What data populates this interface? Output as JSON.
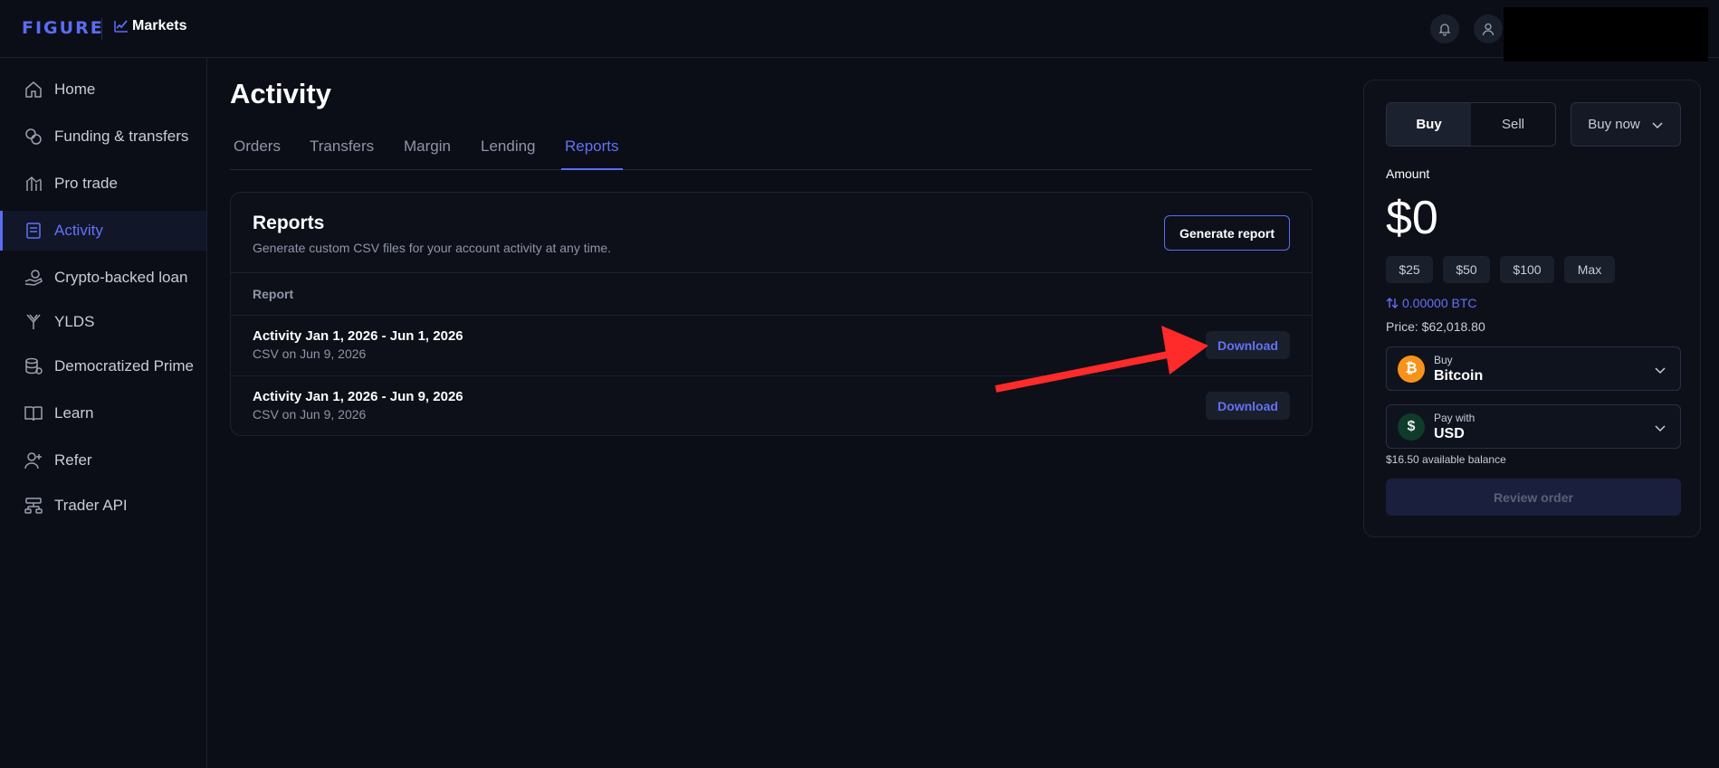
{
  "header": {
    "logo": "FIGURE",
    "product": "Markets"
  },
  "sidebar": {
    "items": [
      {
        "label": "Home",
        "icon": "home-icon"
      },
      {
        "label": "Funding & transfers",
        "icon": "funding-icon"
      },
      {
        "label": "Pro trade",
        "icon": "pro-trade-icon"
      },
      {
        "label": "Activity",
        "icon": "activity-icon",
        "active": true
      },
      {
        "label": "Crypto-backed loan",
        "icon": "loan-icon"
      },
      {
        "label": "YLDS",
        "icon": "ylds-icon"
      },
      {
        "label": "Democratized Prime",
        "icon": "prime-icon"
      },
      {
        "label": "Learn",
        "icon": "book-icon"
      },
      {
        "label": "Refer",
        "icon": "refer-icon"
      },
      {
        "label": "Trader API",
        "icon": "api-icon"
      }
    ]
  },
  "main": {
    "title": "Activity",
    "tabs": [
      {
        "label": "Orders"
      },
      {
        "label": "Transfers"
      },
      {
        "label": "Margin"
      },
      {
        "label": "Lending"
      },
      {
        "label": "Reports",
        "active": true
      }
    ],
    "reports": {
      "title": "Reports",
      "subtitle": "Generate custom CSV files for your account activity at any time.",
      "generate_label": "Generate report",
      "column_header": "Report",
      "rows": [
        {
          "title": "Activity Jan 1, 2026 - Jun 1, 2026",
          "sub": "CSV on Jun 9, 2026",
          "action": "Download"
        },
        {
          "title": "Activity Jan 1, 2026 - Jun 9, 2026",
          "sub": "CSV on Jun 9, 2026",
          "action": "Download"
        }
      ]
    }
  },
  "trade": {
    "buy_label": "Buy",
    "sell_label": "Sell",
    "order_type": "Buy now",
    "amount_label": "Amount",
    "amount_value": "$0",
    "presets": [
      "$25",
      "$50",
      "$100",
      "Max"
    ],
    "conversion": "0.00000 BTC",
    "price": "Price: $62,018.80",
    "asset": {
      "small": "Buy",
      "big": "Bitcoin",
      "symbol": "₿"
    },
    "pay": {
      "small": "Pay with",
      "big": "USD",
      "symbol": "$"
    },
    "balance": "$16.50 available balance",
    "review_label": "Review order"
  },
  "colors": {
    "accent": "#5b6cf5",
    "background": "#0b0e17",
    "annotation_arrow": "#ff2a2a",
    "bitcoin": "#f7931a"
  }
}
